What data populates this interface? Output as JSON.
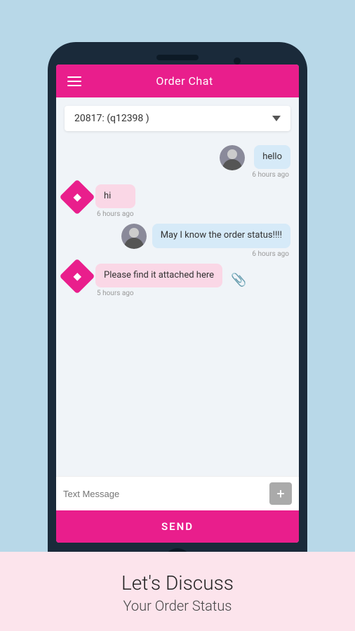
{
  "header": {
    "title": "Order Chat"
  },
  "dropdown": {
    "label": "20817: (q12398 )"
  },
  "messages": [
    {
      "id": "msg1",
      "type": "right",
      "bubble_class": "blue",
      "text": "hello",
      "timestamp": "6 hours ago",
      "avatar": "person"
    },
    {
      "id": "msg2",
      "type": "left",
      "bubble_class": "pink",
      "text": "hi",
      "timestamp": "6 hours ago",
      "avatar": "diamond"
    },
    {
      "id": "msg3",
      "type": "right",
      "bubble_class": "blue",
      "text": "May I know the order status!!!!",
      "timestamp": "6 hours ago",
      "avatar": "person"
    },
    {
      "id": "msg4",
      "type": "left",
      "bubble_class": "pink",
      "text": "Please find it attached here",
      "timestamp": "5 hours ago",
      "avatar": "diamond",
      "has_attachment": true
    }
  ],
  "input": {
    "placeholder": "Text Message"
  },
  "send_button": {
    "label": "SEND"
  },
  "bottom": {
    "headline": "Let's Discuss",
    "subtext": "Your Order Status"
  }
}
